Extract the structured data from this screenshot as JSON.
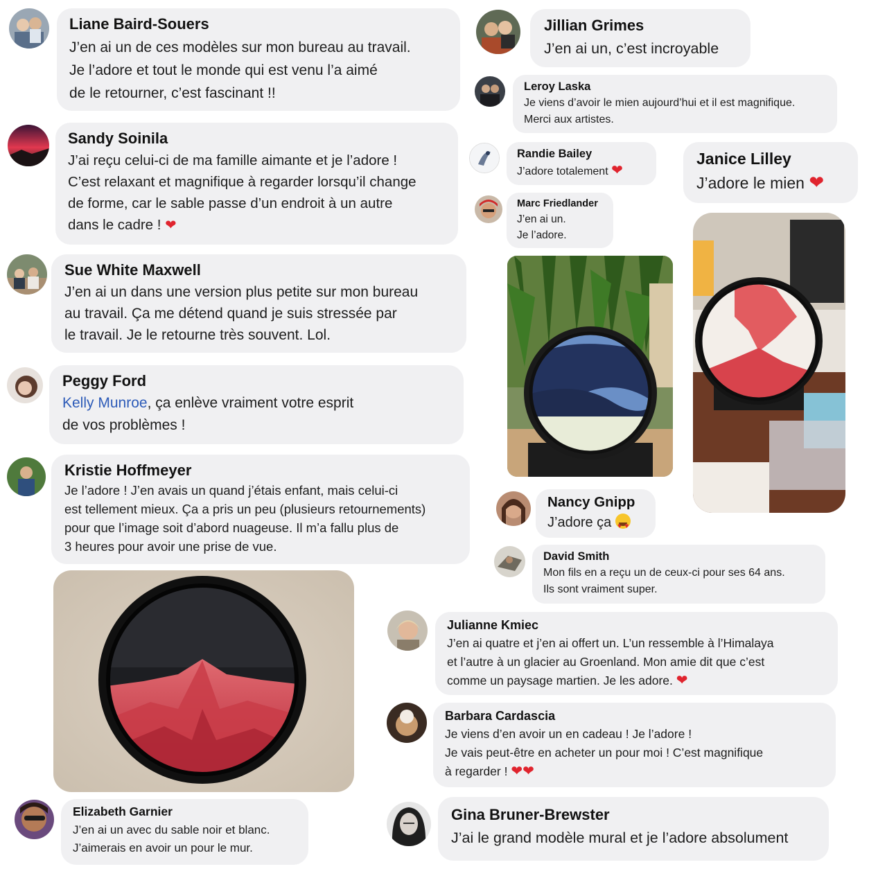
{
  "comments": {
    "liane": {
      "name": "Liane Baird-Souers",
      "text": "J’en ai un de ces modèles sur mon bureau au travail.\nJe l’adore et tout le monde qui est venu l’a aimé\nde le retourner, c’est fascinant !!"
    },
    "sandy": {
      "name": "Sandy Soinila",
      "text": "J’ai reçu celui-ci de ma famille aimante et je l’adore !\nC’est relaxant et magnifique à regarder lorsqu’il change\nde forme, car le sable passe d’un endroit à un autre\ndans le cadre !",
      "reaction": "❤"
    },
    "sue": {
      "name": "Sue White Maxwell",
      "text": "J’en ai un dans une version plus petite sur mon bureau\nau travail. Ça me détend quand je suis stressée par\nle travail. Je le retourne très souvent. Lol."
    },
    "peggy": {
      "name": "Peggy Ford",
      "mention": "Kelly Munroe",
      "text": ", ça enlève vraiment votre esprit\nde vos problèmes !"
    },
    "kristie": {
      "name": "Kristie Hoffmeyer",
      "text": "Je l’adore ! J’en avais un quand j’étais enfant, mais celui-ci\nest tellement mieux. Ça a pris un peu (plusieurs retournements)\npour que l’image soit d’abord nuageuse. Il m’a fallu plus de\n3 heures pour avoir une prise de vue."
    },
    "elizabeth": {
      "name": "Elizabeth Garnier",
      "text": "J’en ai un avec du sable noir et blanc.\nJ’aimerais en avoir un pour le mur."
    },
    "jillian": {
      "name": "Jillian Grimes",
      "text": "J’en ai un, c’est incroyable"
    },
    "leroy": {
      "name": "Leroy Laska",
      "text": "Je viens d’avoir le mien aujourd’hui et il est magnifique.\nMerci aux artistes."
    },
    "randie": {
      "name": "Randie Bailey",
      "text": "J’adore totalement",
      "reaction": "❤"
    },
    "janice": {
      "name": "Janice Lilley",
      "text": "J’adore le mien",
      "reaction": "❤"
    },
    "marc": {
      "name": "Marc Friedlander",
      "text": "J’en ai un.\nJe l’adore."
    },
    "nancy": {
      "name": "Nancy Gnipp",
      "text": "J’adore ça"
    },
    "david": {
      "name": "David Smith",
      "text": "Mon fils en a reçu un de ceux-ci pour ses 64 ans.\nIls sont vraiment super."
    },
    "julianne": {
      "name": "Julianne Kmiec",
      "text": "J’en ai quatre et j’en ai offert un. L’un ressemble à l’Himalaya\net l’autre à un glacier au Groenland. Mon amie dit que c’est\ncomme un paysage martien. Je les adore.",
      "reaction": "❤"
    },
    "barbara": {
      "name": "Barbara Cardascia",
      "text": "Je viens d’en avoir un en cadeau ! Je l’adore !\nJe vais peut-être en acheter un pour moi ! C’est magnifique\nà regarder !",
      "reaction": "❤❤"
    },
    "gina": {
      "name": "Gina Bruner-Brewster",
      "text": "J’ai le grand modèle mural et je l’adore absolument"
    }
  },
  "colors": {
    "bubble": "#f0f0f2",
    "mention": "#2d5bb8",
    "heart": "#e0242e",
    "sand_red": "#d8434c",
    "sand_blue": "#23335e"
  },
  "icons": {
    "reaction_heart": "heart-icon",
    "reaction_emoji": "heart-eyes-emoji-icon"
  }
}
